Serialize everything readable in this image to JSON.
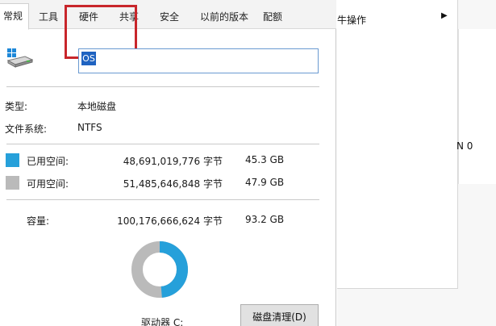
{
  "tabs": [
    {
      "label": "常规",
      "active": true
    },
    {
      "label": "工具",
      "active": false
    },
    {
      "label": "硬件",
      "active": false
    },
    {
      "label": "共享",
      "active": false
    },
    {
      "label": "安全",
      "active": false
    },
    {
      "label": "以前的版本",
      "active": false
    },
    {
      "label": "配额",
      "active": false
    }
  ],
  "drive": {
    "name_value": "OS",
    "type_label": "类型:",
    "type_value": "本地磁盘",
    "fs_label": "文件系统:",
    "fs_value": "NTFS"
  },
  "space": {
    "used": {
      "label": "已用空间:",
      "bytes": "48,691,019,776 字节",
      "size": "45.3 GB",
      "color": "#26a0da"
    },
    "free": {
      "label": "可用空间:",
      "bytes": "51,485,646,848 字节",
      "size": "47.9 GB",
      "color": "#bababa"
    },
    "capacity": {
      "label": "容量:",
      "bytes": "100,176,666,624 字节",
      "size": "93.2 GB"
    },
    "used_fraction": 0.486
  },
  "drive_label": "驱动器 C:",
  "clean_button": "磁盘清理(D)",
  "background": {
    "menu_item": "牛操作",
    "menu_arrow": "▶",
    "side_text": "N 0"
  },
  "icons": {
    "drive": "hard-drive-icon",
    "submenu": "chevron-right-icon"
  }
}
